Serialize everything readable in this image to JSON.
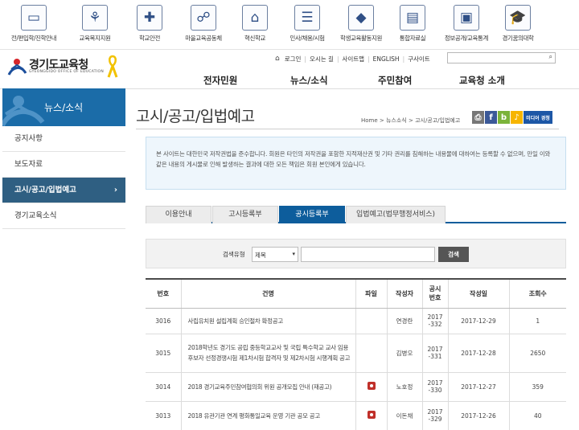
{
  "top_icons": [
    {
      "label": "전/편입학/진학안내",
      "icon": "window-stack-icon",
      "glyph": "▭"
    },
    {
      "label": "교육복지지원",
      "icon": "sprout-icon",
      "glyph": "⚘"
    },
    {
      "label": "학교안전",
      "icon": "medical-cross-icon",
      "glyph": "✚"
    },
    {
      "label": "마을교육공동체",
      "icon": "hands-icon",
      "glyph": "☍"
    },
    {
      "label": "혁신학교",
      "icon": "school-house-icon",
      "glyph": "⌂"
    },
    {
      "label": "인사/채용/시험",
      "icon": "document-icon",
      "glyph": "☰"
    },
    {
      "label": "학생교육활동지원",
      "icon": "shapes-icon",
      "glyph": "◆"
    },
    {
      "label": "통합자료실",
      "icon": "archive-icon",
      "glyph": "▤"
    },
    {
      "label": "정보공개/교육통계",
      "icon": "presentation-board-icon",
      "glyph": "▣"
    },
    {
      "label": "경기꿈의대학",
      "icon": "graduation-cap-icon",
      "glyph": "🎓"
    }
  ],
  "logo": {
    "name": "경기도교육청",
    "english": "GYEONGGIDO OFFICE OF EDUCATION"
  },
  "utility_links": [
    "로그인",
    "오시는 길",
    "사이트맵",
    "ENGLISH",
    "구사이트"
  ],
  "search": {
    "placeholder": ""
  },
  "gnb": [
    "전자민원",
    "뉴스/소식",
    "주민참여",
    "교육청 소개"
  ],
  "lnb": {
    "title": "뉴스/소식",
    "items": [
      "공지사항",
      "보도자료",
      "고시/공고/입법예고",
      "경기교육소식"
    ],
    "active_index": 2
  },
  "page": {
    "title": "고시/공고/입법예고",
    "breadcrumb": "Home > 뉴스소식 > 고시/공고/입법예고",
    "share_label": "미디어 경청"
  },
  "notice": "본 사이트는 대한민국 저작권법을 준수합니다. 회원은 타인의 저작권을 포함한 지적재산권 및 기타 권리를 침해하는 내용물에 대하여는 등록할 수 없으며, 만일 이와 같은 내용의 게시물로 인해 발생하는 결과에 대한 모든 책임은 회원 본인에게 있습니다.",
  "tabs": [
    "이용안내",
    "고시등록부",
    "공시등록부",
    "입법예고(법무행정서비스)"
  ],
  "active_tab": 2,
  "search_form": {
    "label": "검색유형",
    "type_value": "제목",
    "keyword": "",
    "button": "검색"
  },
  "table": {
    "headers": [
      "번호",
      "건명",
      "파일",
      "작성자",
      "공시\n번호",
      "작성일",
      "조회수"
    ],
    "rows": [
      {
        "no": "3016",
        "title": "사립유치원 설립계획 승인절차 확정공고",
        "file": false,
        "author": "연경란",
        "notice_no": "2017\n-332",
        "date": "2017-12-29",
        "views": "1"
      },
      {
        "no": "3015",
        "title": "2018학년도 경기도 공립 중등학교교사 및 국립 특수학교 교사 임용후보자 선정경쟁시험 제1차시험 합격자 및 제2차시험 시행계획 공고",
        "file": false,
        "author": "김병오",
        "notice_no": "2017\n-331",
        "date": "2017-12-28",
        "views": "2650"
      },
      {
        "no": "3014",
        "title": "2018 경기교육주민참여협의회 위원 공개모집 안내 (재공고)",
        "file": true,
        "author": "노호정",
        "notice_no": "2017\n-330",
        "date": "2017-12-27",
        "views": "359"
      },
      {
        "no": "3013",
        "title": "2018 유관기관 연계 평화통일교육 운영 기관 공모 공고",
        "file": true,
        "author": "이돈채",
        "notice_no": "2017\n-329",
        "date": "2017-12-26",
        "views": "40"
      }
    ]
  },
  "colors": {
    "primary": "#0d5d9c",
    "lnb_active": "#2f5f82",
    "lnb_head": "#1b6ca8",
    "notice_bg": "#eef6fc"
  }
}
